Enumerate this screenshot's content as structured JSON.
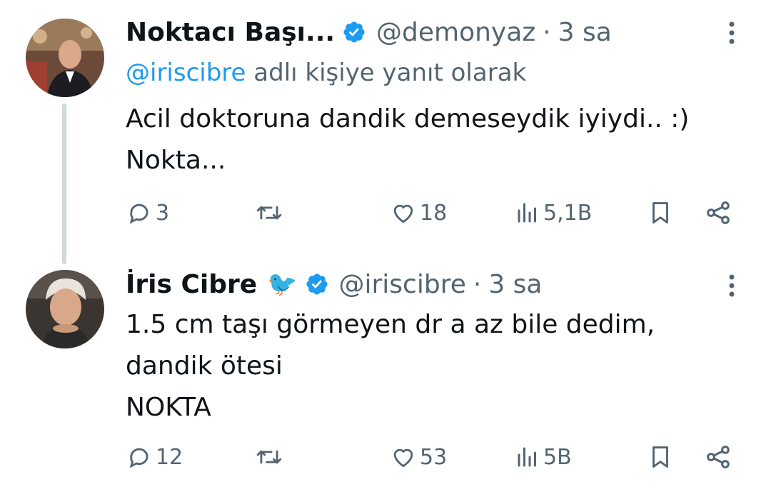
{
  "tweets": [
    {
      "name": "Noktacı Başı...",
      "verified": true,
      "handle": "@demonyaz",
      "time_sep": "·",
      "time": "3 sa",
      "reply_mention": "@iriscibre",
      "reply_suffix": " adlı kişiye yanıt olarak",
      "text_lines": [
        "Acil doktoruna dandik demeseydik iyiydi.. :)",
        "Nokta..."
      ],
      "replies": "3",
      "likes": "18",
      "views": "5,1B"
    },
    {
      "name": "İris Cibre",
      "emoji": "🐦",
      "verified": true,
      "handle": "@iriscibre",
      "time_sep": "·",
      "time": "3 sa",
      "text_lines": [
        "1.5 cm taşı görmeyen dr a az bile dedim,",
        "dandik ötesi",
        "NOKTA"
      ],
      "replies": "12",
      "likes": "53",
      "views": "5B"
    }
  ],
  "icons": {
    "reply": "reply-icon",
    "retweet": "retweet-icon",
    "like": "heart-icon",
    "views": "views-icon",
    "bookmark": "bookmark-icon",
    "share": "share-icon",
    "more": "more-vertical-icon",
    "verified": "verified-badge-icon"
  },
  "colors": {
    "accent": "#1d9bf0",
    "text": "#0f1419",
    "secondary": "#536471",
    "thread_line": "#cfd9de"
  }
}
